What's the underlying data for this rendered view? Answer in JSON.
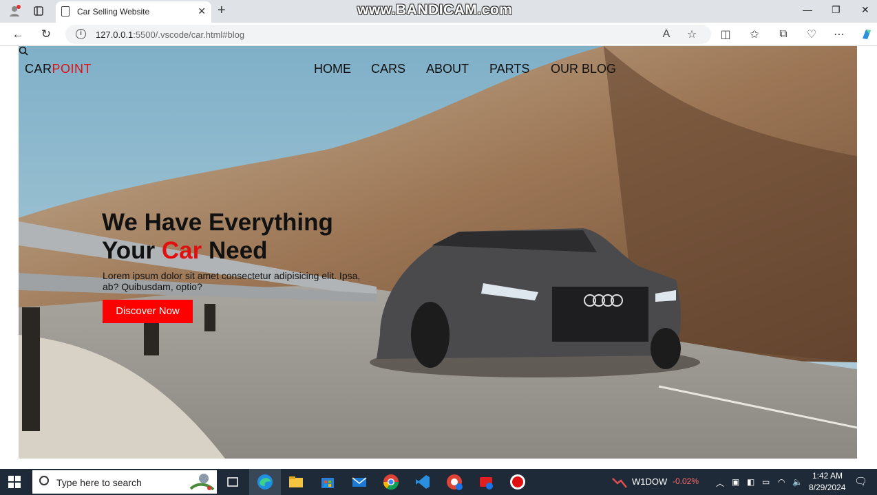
{
  "browser": {
    "tab_title": "Car Selling Website",
    "url_host": "127.0.0.1",
    "url_rest": ":5500/.vscode/car.html#blog",
    "watermark": "www.BANDICAM.com"
  },
  "site": {
    "logo_part1": "CAR",
    "logo_part2": "POINT",
    "nav": [
      "HOME",
      "CARS",
      "ABOUT",
      "PARTS",
      "OUR BLOG"
    ],
    "headline_line1": "We Have Everything",
    "headline_line2_a": "Your ",
    "headline_line2_car": "Car",
    "headline_line2_b": " Need",
    "lorem": "Lorem ipsum dolor sit amet consectetur adipisicing elit. Ipsa, ab? Quibusdam, optio?",
    "cta_label": "Discover Now",
    "accent_color": "#ff0000"
  },
  "taskbar": {
    "search_placeholder": "Type here to search",
    "ticker_symbol": "W1DOW",
    "ticker_change": "-0.02%",
    "time": "1:42 AM",
    "date": "8/29/2024"
  }
}
